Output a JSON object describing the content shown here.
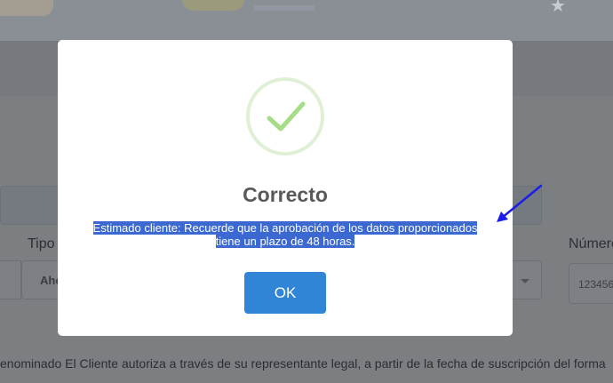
{
  "background": {
    "tipo_label": "Tipo",
    "select_value": "Aho",
    "numero_label": "Número",
    "input_value": "123456",
    "paragraph": "enominado El Cliente autoriza a través de su representante legal, a partir de la fecha de suscripción del forma"
  },
  "dialog": {
    "title": "Correcto",
    "message_line1": "Estimado cliente: Recuerde que la aprobación de los datos proporcionados",
    "message_line2": "tiene un plazo de 48 horas.",
    "ok_label": "OK",
    "icon": "checkmark-icon",
    "accent_color": "#3085d6",
    "check_color": "#a5dc86",
    "highlight_color": "#3b69d1"
  },
  "annotation": {
    "icon": "arrow-icon",
    "color": "#1a1ee8"
  }
}
